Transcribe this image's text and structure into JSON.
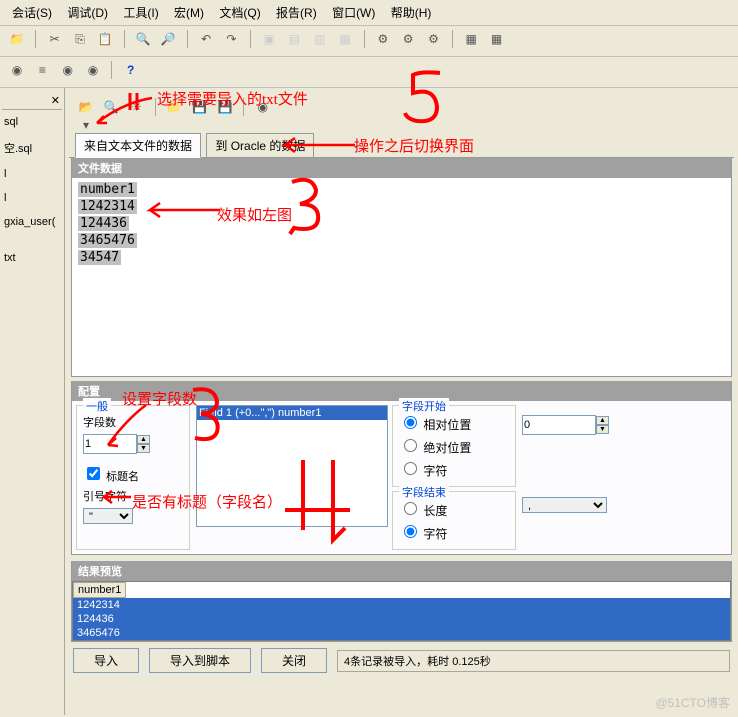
{
  "menu": {
    "items": [
      "会话(S)",
      "调试(D)",
      "工具(I)",
      "宏(M)",
      "文档(Q)",
      "报告(R)",
      "窗口(W)",
      "帮助(H)"
    ]
  },
  "sidebar": {
    "items": [
      "sql",
      "空.sql",
      "l",
      "l",
      "gxia_user(",
      "",
      "txt"
    ]
  },
  "tabs": {
    "t1": "来自文本文件的数据",
    "t2": "到 Oracle 的数据"
  },
  "sections": {
    "fileData": "文件数据",
    "config": "配置",
    "general": "一般",
    "fieldStart": "字段开始",
    "fieldEnd": "字段结束",
    "resultPreview": "结果预览"
  },
  "fileLines": [
    "number1",
    "1242314",
    "124436",
    "3465476",
    "34547"
  ],
  "labels": {
    "fieldCount": "字段数",
    "titleName": "标题名",
    "quoteChar": "引号字符",
    "relPos": "相对位置",
    "absPos": "绝对位置",
    "char": "字符",
    "length": "长度"
  },
  "values": {
    "fieldCount": "1",
    "quoteChar": "\"",
    "listSel": "Field 1  (+0...\",\") number1",
    "spinVal": "0",
    "comboVal": ","
  },
  "preview": {
    "header": "number1",
    "rows": [
      "1242314",
      "124436",
      "3465476"
    ]
  },
  "buttons": {
    "import": "导入",
    "toScript": "导入到脚本",
    "close": "关闭"
  },
  "status": "4条记录被导入，耗时 0.125秒",
  "annotations": {
    "a1": "选择需要导入的txt文件",
    "a2": "操作之后切换界面",
    "a3": "效果如左图",
    "a4": "设置字段数",
    "a5": "是否有标题（字段名）"
  },
  "watermark": "@51CTO博客"
}
